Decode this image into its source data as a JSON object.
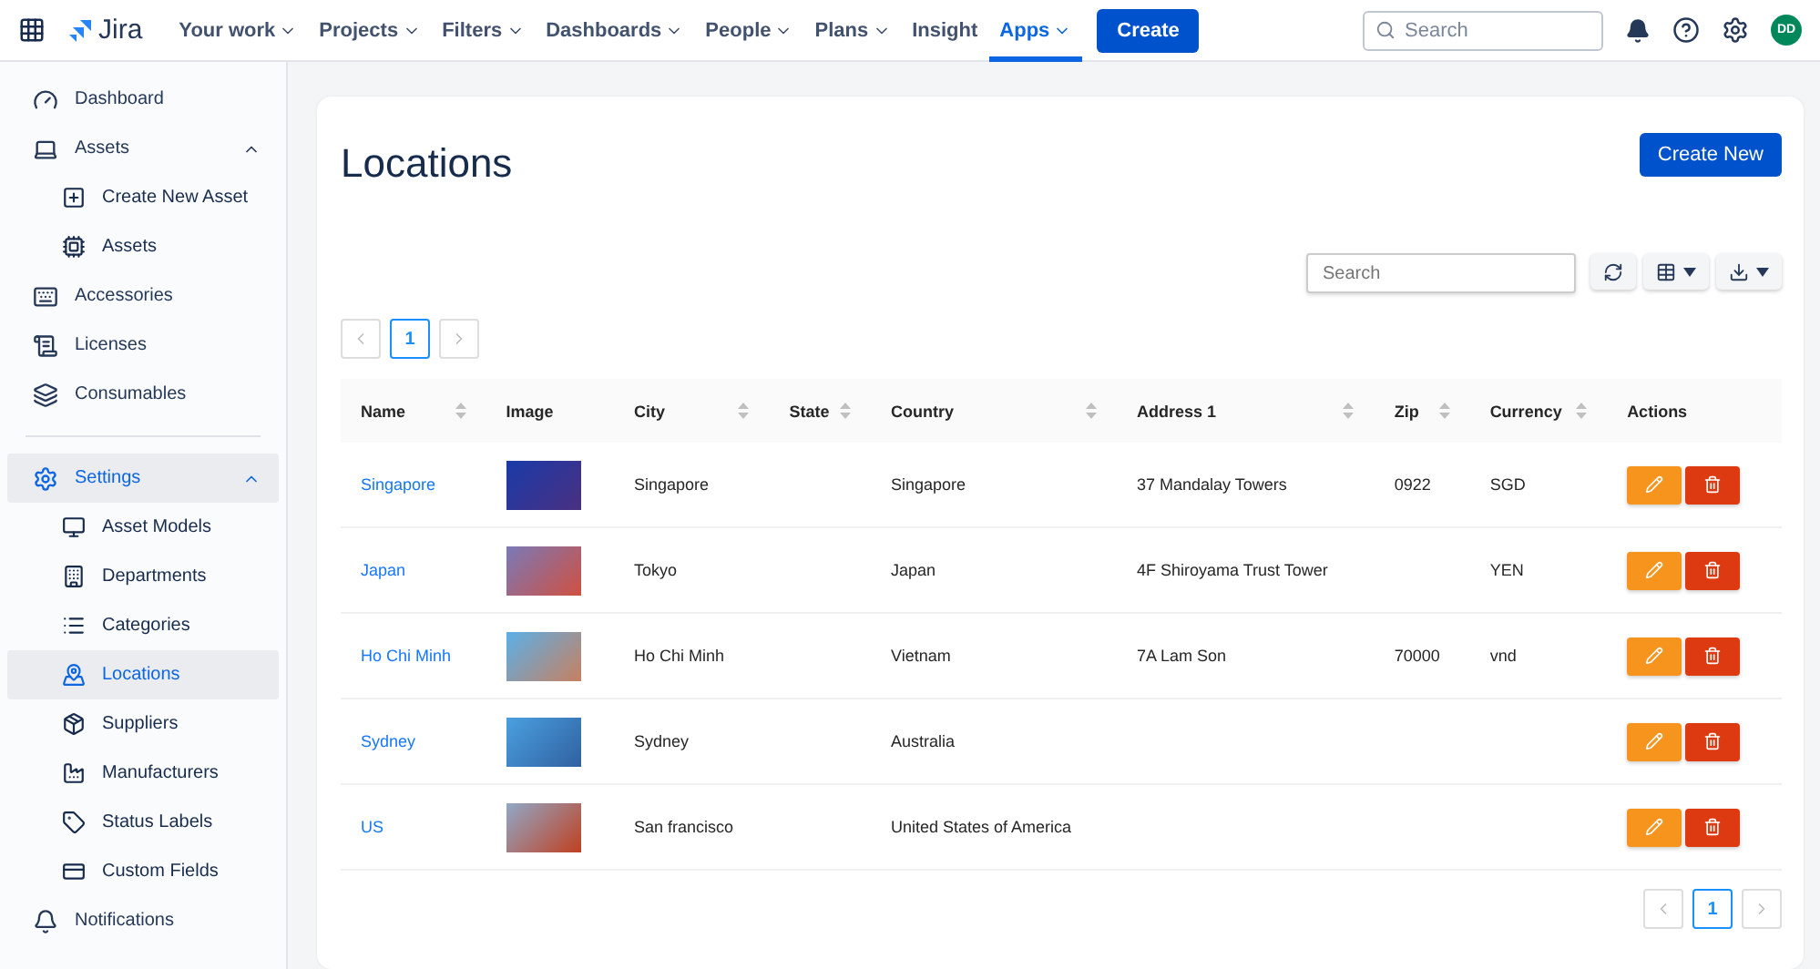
{
  "topbar": {
    "product": "Jira",
    "nav": [
      {
        "label": "Your work",
        "dropdown": true,
        "selected": false
      },
      {
        "label": "Projects",
        "dropdown": true,
        "selected": false
      },
      {
        "label": "Filters",
        "dropdown": true,
        "selected": false
      },
      {
        "label": "Dashboards",
        "dropdown": true,
        "selected": false
      },
      {
        "label": "People",
        "dropdown": true,
        "selected": false
      },
      {
        "label": "Plans",
        "dropdown": true,
        "selected": false
      },
      {
        "label": "Insight",
        "dropdown": false,
        "selected": false
      },
      {
        "label": "Apps",
        "dropdown": true,
        "selected": true
      }
    ],
    "create_button": "Create",
    "search": {
      "placeholder": "Search"
    },
    "avatar": "DD"
  },
  "sidebar": {
    "items": [
      {
        "label": "Dashboard",
        "selected": false
      },
      {
        "label": "Assets",
        "selected": false,
        "expanded": true,
        "children": [
          {
            "label": "Create New Asset",
            "selected": false
          },
          {
            "label": "Assets",
            "selected": false
          }
        ]
      },
      {
        "label": "Accessories",
        "selected": false
      },
      {
        "label": "Licenses",
        "selected": false
      },
      {
        "label": "Consumables",
        "selected": false
      },
      {
        "label": "Settings",
        "selected": true,
        "expanded": true,
        "children": [
          {
            "label": "Asset Models",
            "selected": false
          },
          {
            "label": "Departments",
            "selected": false
          },
          {
            "label": "Categories",
            "selected": false
          },
          {
            "label": "Locations",
            "selected": true
          },
          {
            "label": "Suppliers",
            "selected": false
          },
          {
            "label": "Manufacturers",
            "selected": false
          },
          {
            "label": "Status Labels",
            "selected": false
          },
          {
            "label": "Custom Fields",
            "selected": false
          }
        ]
      },
      {
        "label": "Notifications",
        "selected": false
      }
    ]
  },
  "page": {
    "title": "Locations",
    "create_button": "Create New",
    "search": {
      "placeholder": "Search"
    },
    "pagination_top": [
      {
        "label": "1",
        "selected": true
      }
    ],
    "pagination_bottom": [
      {
        "label": "1",
        "selected": true
      }
    ]
  },
  "table": {
    "columns": [
      {
        "label": "Name",
        "sortable": true
      },
      {
        "label": "Image",
        "sortable": false
      },
      {
        "label": "City",
        "sortable": true
      },
      {
        "label": "State",
        "sortable": true
      },
      {
        "label": "Country",
        "sortable": true
      },
      {
        "label": "Address 1",
        "sortable": true
      },
      {
        "label": "Zip",
        "sortable": true
      },
      {
        "label": "Currency",
        "sortable": true
      },
      {
        "label": "Actions",
        "sortable": false
      }
    ],
    "rows": [
      {
        "name": "Singapore",
        "city": "Singapore",
        "state": "",
        "country": "Singapore",
        "address": "37 Mandalay Towers",
        "zip": "0922",
        "currency": "SGD"
      },
      {
        "name": "Japan",
        "city": "Tokyo",
        "state": "",
        "country": "Japan",
        "address": "4F Shiroyama Trust Tower",
        "zip": "",
        "currency": "YEN"
      },
      {
        "name": "Ho Chi Minh",
        "city": "Ho Chi Minh",
        "state": "",
        "country": "Vietnam",
        "address": "7A Lam Son",
        "zip": "70000",
        "currency": "vnd"
      },
      {
        "name": "Sydney",
        "city": "Sydney",
        "state": "",
        "country": "Australia",
        "address": "",
        "zip": "",
        "currency": ""
      },
      {
        "name": "US",
        "city": "San francisco",
        "state": "",
        "country": "United States of America",
        "address": "",
        "zip": "",
        "currency": ""
      }
    ]
  }
}
